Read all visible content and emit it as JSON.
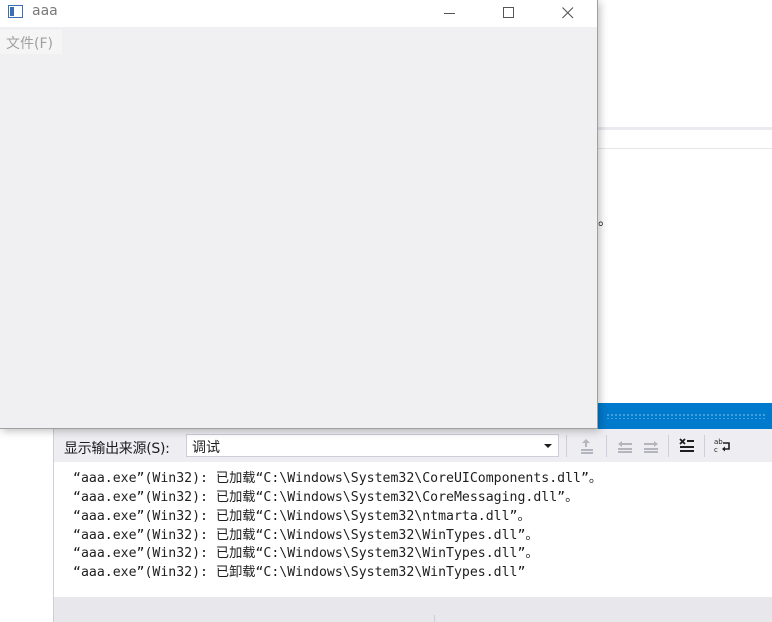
{
  "app_window": {
    "title": "aaa",
    "menu": [
      {
        "label": "文件(F)"
      }
    ]
  },
  "ide": {
    "fragment_text": "。",
    "output_panel": {
      "source_label": "显示输出来源(S):",
      "source_value": "调试",
      "toolbar_icons": [
        "find-message-in-code-icon",
        "previous-message-icon",
        "next-message-icon",
        "clear-all-icon",
        "toggle-word-wrap-icon"
      ],
      "lines": [
        "“aaa.exe”(Win32): 已加载“C:\\Windows\\System32\\CoreUIComponents.dll”。",
        "“aaa.exe”(Win32): 已加载“C:\\Windows\\System32\\CoreMessaging.dll”。",
        "“aaa.exe”(Win32): 已加载“C:\\Windows\\System32\\ntmarta.dll”。",
        "“aaa.exe”(Win32): 已加载“C:\\Windows\\System32\\WinTypes.dll”。",
        "“aaa.exe”(Win32): 已加载“C:\\Windows\\System32\\WinTypes.dll”。",
        "“aaa.exe”(Win32): 已卸载“C:\\Windows\\System32\\WinTypes.dll”"
      ]
    }
  },
  "colors": {
    "ide_accent": "#007acc",
    "window_client": "#f0f0f3",
    "titlebar": "#ffffff"
  }
}
